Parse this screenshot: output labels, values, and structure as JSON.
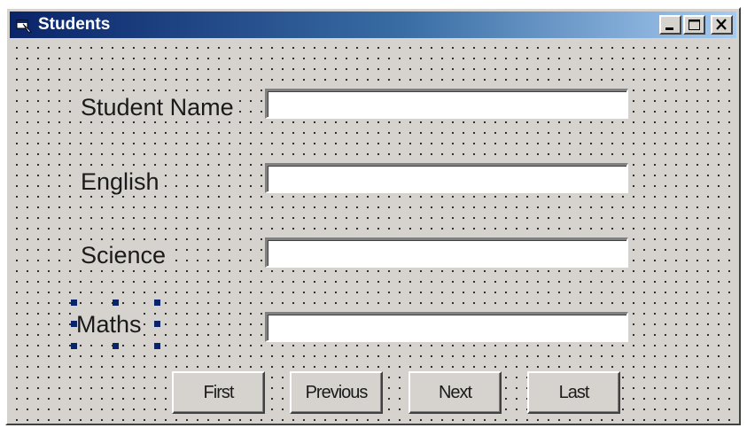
{
  "window": {
    "title": "Students",
    "icon": "form-icon",
    "caption_buttons": [
      "minimize-icon",
      "maximize-icon",
      "close-icon"
    ]
  },
  "form": {
    "fields": [
      {
        "label": "Student Name",
        "value": ""
      },
      {
        "label": "English",
        "value": ""
      },
      {
        "label": "Science",
        "value": ""
      },
      {
        "label": "Maths",
        "value": "",
        "selected": true
      }
    ],
    "buttons": [
      "First",
      "Previous",
      "Next",
      "Last"
    ]
  },
  "colors": {
    "title_start": "#0a246a",
    "title_end": "#a6caf0",
    "face": "#d6d3ce",
    "selection_handle": "#0a246a"
  }
}
